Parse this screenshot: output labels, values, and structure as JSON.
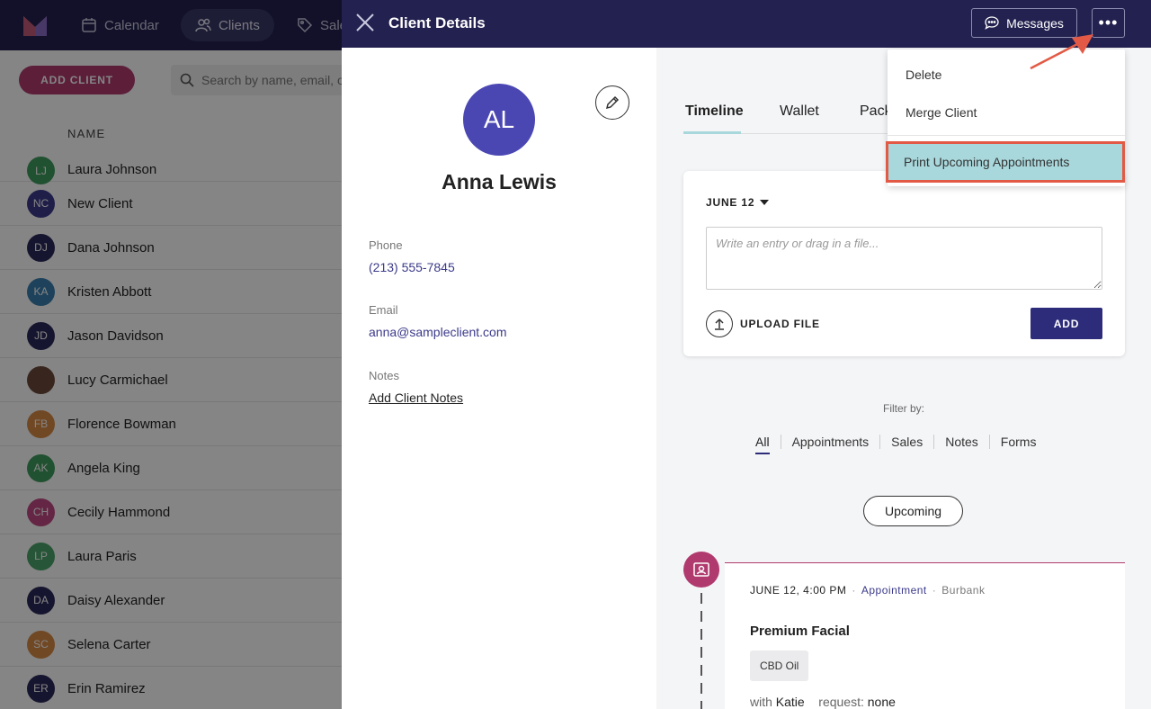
{
  "app": {
    "nav": [
      {
        "label": "Calendar",
        "icon": "calendar-icon"
      },
      {
        "label": "Clients",
        "icon": "users-icon",
        "active": true
      },
      {
        "label": "Sale",
        "icon": "tag-icon"
      }
    ],
    "add_client_label": "ADD CLIENT",
    "search_placeholder": "Search by name, email, o",
    "column_header": "NAME",
    "clients": [
      {
        "initials": "LJ",
        "name": "Laura Johnson",
        "color": "#3f9b5c"
      },
      {
        "initials": "NC",
        "name": "New Client",
        "color": "#3d3a8c"
      },
      {
        "initials": "DJ",
        "name": "Dana Johnson",
        "color": "#2b2a5a"
      },
      {
        "initials": "KA",
        "name": "Kristen Abbott",
        "color": "#3a7fae"
      },
      {
        "initials": "JD",
        "name": "Jason Davidson",
        "color": "#2b2a5a"
      },
      {
        "initials": "",
        "name": "Lucy Carmichael",
        "color": "#6b4a3a"
      },
      {
        "initials": "FB",
        "name": "Florence Bowman",
        "color": "#d98a45"
      },
      {
        "initials": "AK",
        "name": "Angela King",
        "color": "#3f9b5c"
      },
      {
        "initials": "CH",
        "name": "Cecily Hammond",
        "color": "#c04a82"
      },
      {
        "initials": "LP",
        "name": "Laura Paris",
        "color": "#4aa36a"
      },
      {
        "initials": "DA",
        "name": "Daisy Alexander",
        "color": "#2b2a5a"
      },
      {
        "initials": "SC",
        "name": "Selena Carter",
        "color": "#d98a45"
      },
      {
        "initials": "ER",
        "name": "Erin Ramirez",
        "color": "#2b2a5a"
      }
    ]
  },
  "panel": {
    "title": "Client Details",
    "messages_label": "Messages",
    "more_label": "•••",
    "client": {
      "initials": "AL",
      "name": "Anna Lewis",
      "phone_label": "Phone",
      "phone": "(213) 555-7845",
      "email_label": "Email",
      "email": "anna@sampleclient.com",
      "notes_label": "Notes",
      "notes_link": "Add Client Notes"
    },
    "tabs": [
      "Timeline",
      "Wallet",
      "Pack"
    ],
    "entry": {
      "date": "JUNE 12",
      "placeholder": "Write an entry or drag in a file...",
      "upload_label": "UPLOAD FILE",
      "add_label": "ADD"
    },
    "filter": {
      "label": "Filter by:",
      "items": [
        "All",
        "Appointments",
        "Sales",
        "Notes",
        "Forms"
      ]
    },
    "upcoming_label": "Upcoming",
    "appointment": {
      "datetime": "JUNE 12, 4:00 PM",
      "type": "Appointment",
      "location": "Burbank",
      "service": "Premium Facial",
      "addon": "CBD Oil",
      "with_label": "with",
      "staff": "Katie",
      "request_label": "request:",
      "request": "none"
    },
    "menu": {
      "items": [
        "Delete",
        "Merge Client",
        "Print Upcoming Appointments"
      ]
    }
  },
  "colors": {
    "header": "#23214f",
    "accent": "#b03a6e",
    "primary_button": "#2d2c7a",
    "highlight": "#a9d8dc",
    "annotation": "#e25a45"
  }
}
